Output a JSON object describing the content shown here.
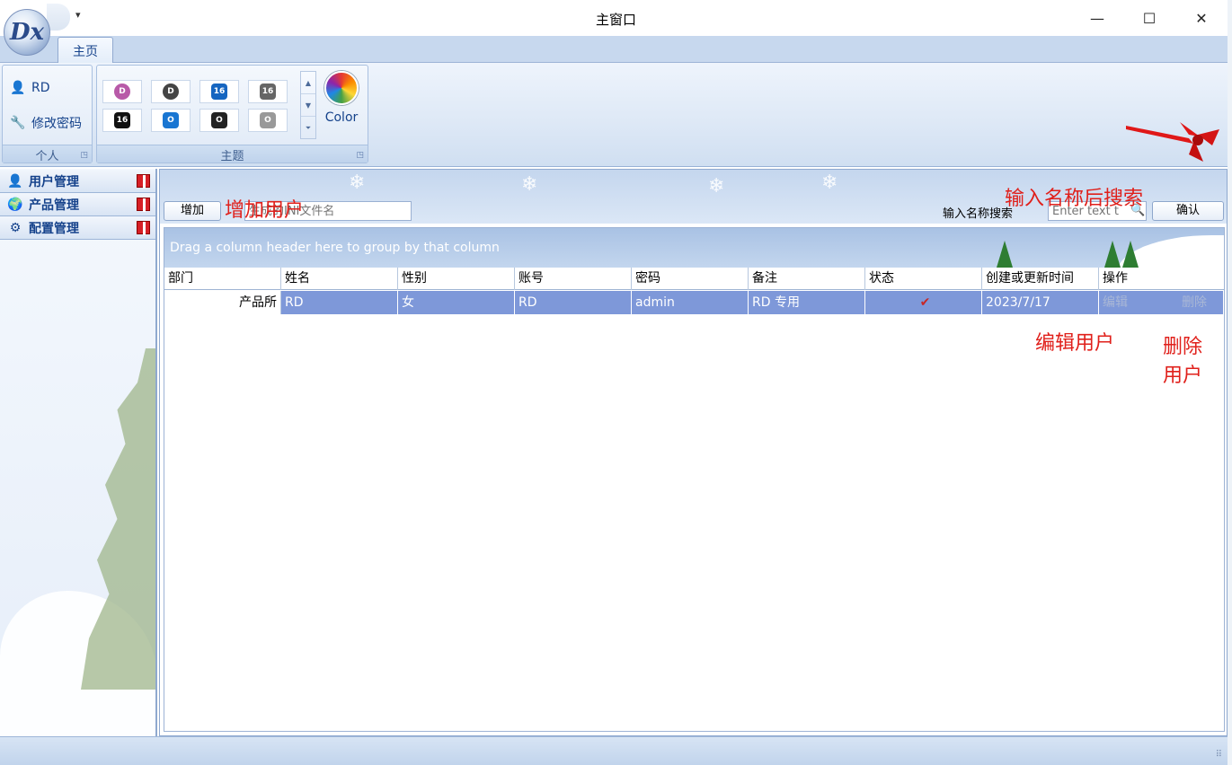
{
  "window": {
    "title": "主窗口",
    "minimize_label": "—",
    "maximize_label": "☐",
    "close_label": "✕"
  },
  "ribbon": {
    "tab_home": "主页",
    "personal": {
      "caption": "个人",
      "user_label": "RD",
      "change_pwd_label": "修改密码"
    },
    "theme": {
      "caption": "主题",
      "color_label": "Color"
    }
  },
  "sidebar": {
    "items": [
      {
        "label": "用户管理",
        "icon": "user-icon"
      },
      {
        "label": "产品管理",
        "icon": "product-icon"
      },
      {
        "label": "配置管理",
        "icon": "gear-icon"
      }
    ]
  },
  "toolbar": {
    "add_label": "增加",
    "ini_placeholder": "生成的INI文件名",
    "search_label": "输入名称搜索",
    "search_placeholder": "Enter text t",
    "ok_label": "确认"
  },
  "grid": {
    "group_panel_text": "Drag a column header here to group by that column",
    "columns": [
      "部门",
      "姓名",
      "性别",
      "账号",
      "密码",
      "备注",
      "状态",
      "创建或更新时间",
      "操作"
    ],
    "rows": [
      {
        "dept": "产品所",
        "name": "RD",
        "gender": "女",
        "account": "RD",
        "password": "admin",
        "remark": "RD 专用",
        "status_icon": "check-icon",
        "time": "2023/7/17",
        "edit_label": "编辑",
        "delete_label": "删除"
      }
    ]
  },
  "annotations": {
    "add_user": "增加用户",
    "search_hint": "输入名称后搜索",
    "edit_user": "编辑用户",
    "delete_user_1": "删除",
    "delete_user_2": "用户"
  },
  "colors": {
    "accent": "#15428b",
    "selected_row": "#7e98d9",
    "annotation": "#e0201b"
  }
}
